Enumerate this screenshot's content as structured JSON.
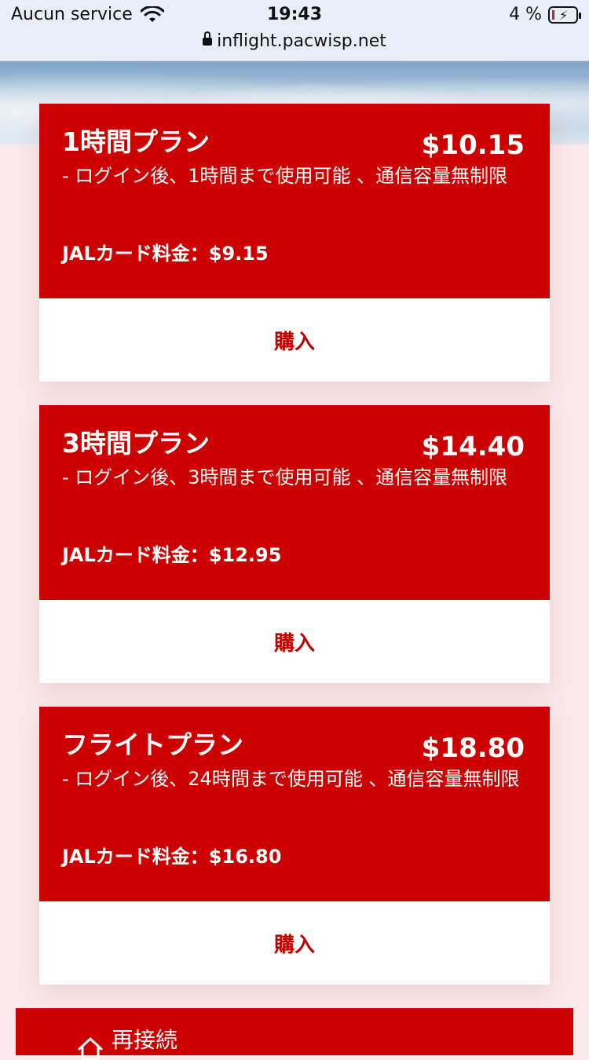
{
  "status_bar": {
    "carrier": "Aucun service",
    "time": "19:43",
    "battery_percent": "4 %",
    "url": "inflight.pacwisp.net",
    "battery_level": 0.04
  },
  "plans": [
    {
      "name": "1時間プラン",
      "price": "$10.15",
      "description": "- ログイン後、1時間まで使用可能 、通信容量無制限",
      "card_price": "JALカード料金：$9.15",
      "buy_label": "購入"
    },
    {
      "name": "3時間プラン",
      "price": "$14.40",
      "description": "- ログイン後、3時間まで使用可能 、通信容量無制限",
      "card_price": "JALカード料金：$12.95",
      "buy_label": "購入"
    },
    {
      "name": "フライトプラン",
      "price": "$18.80",
      "description": "- ログイン後、24時間まで使用可能 、通信容量無制限",
      "card_price": "JALカード料金：$16.80",
      "buy_label": "購入"
    }
  ],
  "reconnect": {
    "label": "再接続",
    "icon": "home-icon"
  },
  "colors": {
    "accent": "#cc0000",
    "background": "#f9e9ea"
  }
}
